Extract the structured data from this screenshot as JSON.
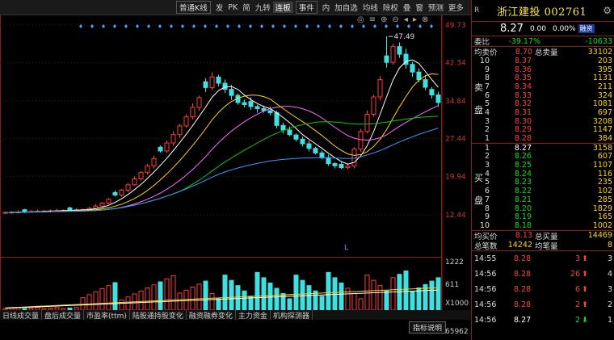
{
  "toolbar": {
    "items": [
      {
        "label": "普通K线",
        "type": "select"
      },
      {
        "label": "发"
      },
      {
        "label": "PK"
      },
      {
        "label": "简"
      },
      {
        "label": "九转"
      },
      {
        "label": "连板",
        "active": true
      },
      {
        "label": "事件",
        "type": "select"
      },
      {
        "label": "内"
      },
      {
        "label": "加自选"
      },
      {
        "label": "均线"
      },
      {
        "label": "除权"
      },
      {
        "label": "叠"
      },
      {
        "label": "窗"
      },
      {
        "label": "预测"
      },
      {
        "label": "更多"
      }
    ]
  },
  "chart_data": {
    "type": "candlestick",
    "price_ticks": [
      "49.73",
      "42.34",
      "34.84",
      "27.44",
      "19.94",
      "12.44"
    ],
    "volume_ticks": [
      "1222",
      "611",
      "X1000"
    ],
    "bottom_value": "65962",
    "high_label": "47.49",
    "marker": "L",
    "colors": {
      "up": "#ff3b3b",
      "down": "#40e0e0",
      "ma5": "#ffffff",
      "ma10": "#ffd700",
      "ma20": "#ff66ff",
      "ma30": "#00cc00",
      "ma60": "#3399ff"
    }
  },
  "tabs": [
    "日线成交量",
    "盘后成交量",
    "市盈率(ttm)",
    "陆股通持股变化",
    "融资融券变化",
    "主力资金",
    "机构探测器"
  ],
  "indicator_button": "指标说明",
  "stock": {
    "r": "R",
    "name": "浙江建投 002761",
    "price": "8.27",
    "change": "0.00",
    "pct": "0.00%",
    "fin": "融资"
  },
  "weibi": {
    "label": "委比",
    "pct": "-39.17%",
    "diff": "-10633"
  },
  "junmai": {
    "label": "均卖价",
    "price": "8.70",
    "label2": "总卖量",
    "vol": "33102"
  },
  "sell": [
    {
      "n": "10",
      "p": "8.37",
      "v": "203"
    },
    {
      "n": "9",
      "p": "8.36",
      "v": "395"
    },
    {
      "n": "8",
      "p": "8.35",
      "v": "1131"
    },
    {
      "n": "7",
      "p": "8.34",
      "v": "211"
    },
    {
      "n": "6",
      "p": "8.33",
      "v": "324"
    },
    {
      "n": "5",
      "p": "8.32",
      "v": "1081"
    },
    {
      "n": "4",
      "p": "8.31",
      "v": "697"
    },
    {
      "n": "3",
      "p": "8.30",
      "v": "3208"
    },
    {
      "n": "2",
      "p": "8.29",
      "v": "1147"
    },
    {
      "n": "1",
      "p": "8.28",
      "v": "384"
    }
  ],
  "sell_side": "卖盘",
  "buy_side": "买盘",
  "buy": [
    {
      "n": "1",
      "p": "8.27",
      "v": "3158"
    },
    {
      "n": "2",
      "p": "8.26",
      "v": "607"
    },
    {
      "n": "3",
      "p": "8.25",
      "v": "1107"
    },
    {
      "n": "4",
      "p": "8.24",
      "v": "116"
    },
    {
      "n": "5",
      "p": "8.23",
      "v": "235"
    },
    {
      "n": "6",
      "p": "8.22",
      "v": "102"
    },
    {
      "n": "7",
      "p": "8.21",
      "v": "285"
    },
    {
      "n": "8",
      "p": "8.20",
      "v": "1829"
    },
    {
      "n": "9",
      "p": "8.19",
      "v": "165"
    },
    {
      "n": "10",
      "p": "8.18",
      "v": "1002"
    }
  ],
  "junmai2": {
    "label": "均买价",
    "price": "8.13",
    "label2": "总买量",
    "vol": "14469"
  },
  "bishu": {
    "label": "总笔数",
    "val": "14242",
    "label2": "均笔量",
    "vol": "8"
  },
  "trades": [
    {
      "t": "14:55",
      "p": "8.28",
      "v": "3",
      "dir": "up",
      "n": "3"
    },
    {
      "t": "14:56",
      "p": "8.28",
      "v": "26",
      "dir": "up",
      "n": "4"
    },
    {
      "t": "14:56",
      "p": "8.28",
      "v": "6",
      "dir": "up",
      "n": "3"
    },
    {
      "t": "14:56",
      "p": "8.28",
      "v": "2",
      "dir": "up",
      "n": "2"
    },
    {
      "t": "14:56",
      "p": "8.27",
      "v": "2",
      "dir": "down",
      "n": "1"
    }
  ]
}
